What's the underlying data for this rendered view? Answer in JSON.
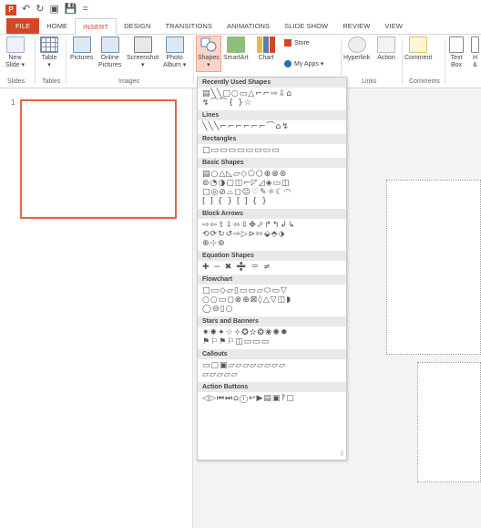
{
  "qat": {
    "logo": "P",
    "save": "💾",
    "undo": "↶",
    "redo": "↻",
    "start": "▣",
    "customize": "="
  },
  "tabs": [
    "FILE",
    "HOME",
    "INSERT",
    "DESIGN",
    "TRANSITIONS",
    "ANIMATIONS",
    "SLIDE SHOW",
    "REVIEW",
    "VIEW"
  ],
  "ribbon": {
    "buttons": {
      "new_slide": "New\nSlide ▾",
      "table": "Table\n▾",
      "pictures": "Pictures",
      "online_pictures": "Online\nPictures",
      "screenshot": "Screenshot\n▾",
      "photo_album": "Photo\nAlbum ▾",
      "shapes": "Shapes\n▾",
      "smartart": "SmartArt",
      "chart": "Chart",
      "store": "Store",
      "my_apps": "My Apps ▾",
      "hyperlink": "Hyperlink",
      "action": "Action",
      "comment": "Comment",
      "text_box": "Text\nBox",
      "header_footer": "H\n&"
    },
    "groups": {
      "slides": "Slides",
      "tables": "Tables",
      "images": "Images",
      "links": "Links",
      "comments": "Comments"
    }
  },
  "slides": {
    "number": "1"
  },
  "gallery": {
    "sections": [
      {
        "title": "Recently Used Shapes",
        "rows": [
          "▤╲╲□○▭△⌐⌐⇨⇩⌂",
          "↯⌒⌒{ }☆"
        ]
      },
      {
        "title": "Lines",
        "rows": [
          "╲╲╲⌐⌐⌐⌐⌐⌐⌒⌂↯"
        ]
      },
      {
        "title": "Rectangles",
        "rows": [
          "□▭▭▭▭▭▭▭▭"
        ]
      },
      {
        "title": "Basic Shapes",
        "rows": [
          "▤○△◺▱◇⬠⬡⊕⊗⊛",
          "⊚◔◑▢◫⌐◸◿◈▭◫",
          "□◎⊘⌓◻☺♡✎☼☾◠",
          "[ ] { } [ ] { }"
        ]
      },
      {
        "title": "Block Arrows",
        "rows": [
          "⇨⇦⇧⇩⬄⇳✥⬀↱↰↲↳",
          "⟲⟳↻↺⇨▷⊳⇰⬙⬘⬗",
          "⊕⊹⊛"
        ]
      },
      {
        "title": "Equation Shapes",
        "rows": [
          "✚ − ✖ ➗ ＝ ≠"
        ]
      },
      {
        "title": "Flowchart",
        "rows": [
          "□▭◇▱▯▭▭▱⬭▭▽",
          "○○▭◻⊗⊕⊠◊△▽◫◗",
          "◯⊖▯○"
        ]
      },
      {
        "title": "Stars and Banners",
        "rows": [
          "✷✸✦☆✧✪✫❂❀✺✹",
          "⚑⚐⚑⚐◫▭▭▭"
        ]
      },
      {
        "title": "Callouts",
        "rows": [
          "▭▢▣▱▱▱▱▱▱▱▱",
          "▱▱▱▱▱"
        ]
      },
      {
        "title": "Action Buttons",
        "rows": [
          "◁▷⏮⏭⌂ⓘ↩▶▤▣?▢"
        ]
      }
    ]
  }
}
